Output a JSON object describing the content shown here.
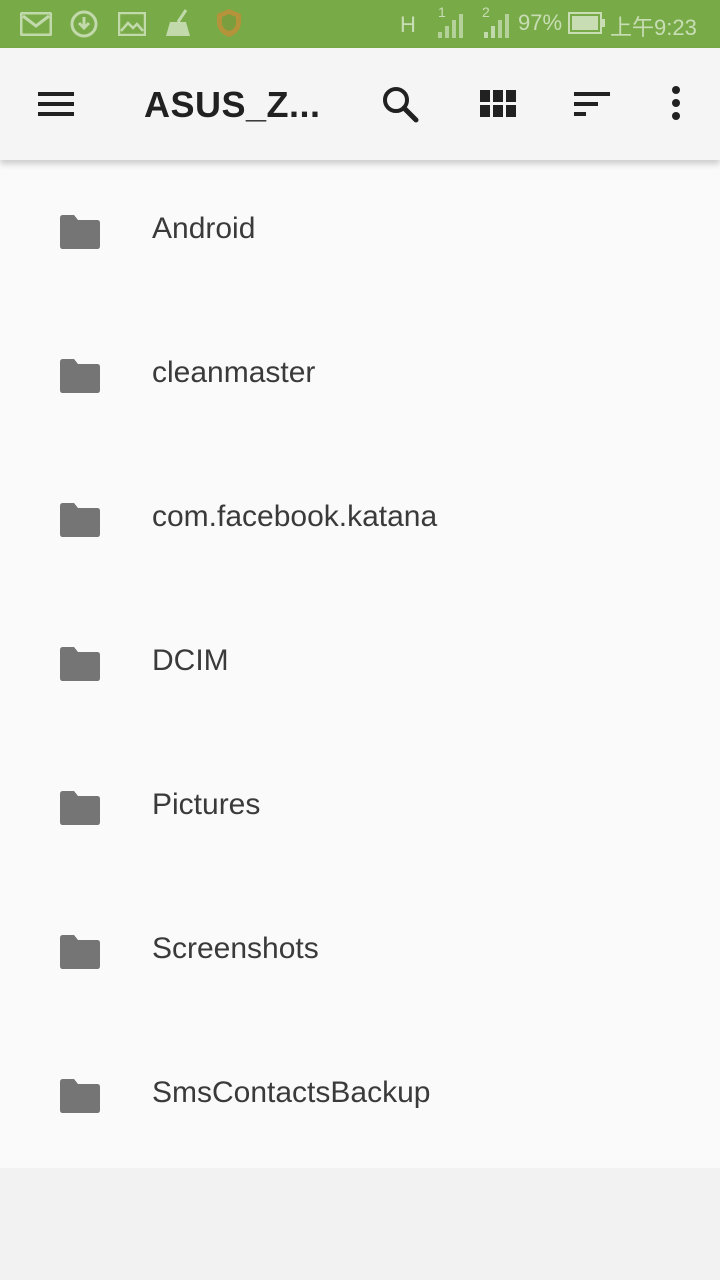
{
  "status_bar": {
    "network_type": "H",
    "sim1": "1",
    "sim2": "2",
    "battery": "97%",
    "time": "上午9:23",
    "icons": [
      "gmail-icon",
      "download-icon",
      "image-icon",
      "cleaner-icon",
      "shield-icon"
    ]
  },
  "toolbar": {
    "title": "ASUS_Z...",
    "icons": [
      "menu-icon",
      "search-icon",
      "grid-view-icon",
      "sort-icon",
      "more-vert-icon"
    ]
  },
  "colors": {
    "status_bar": "#78ab47",
    "folder_icon": "#757575",
    "text": "#3a3a3a"
  },
  "folders": [
    {
      "name": "Android"
    },
    {
      "name": "cleanmaster"
    },
    {
      "name": "com.facebook.katana"
    },
    {
      "name": "DCIM"
    },
    {
      "name": "Pictures"
    },
    {
      "name": "Screenshots"
    },
    {
      "name": "SmsContactsBackup"
    }
  ]
}
